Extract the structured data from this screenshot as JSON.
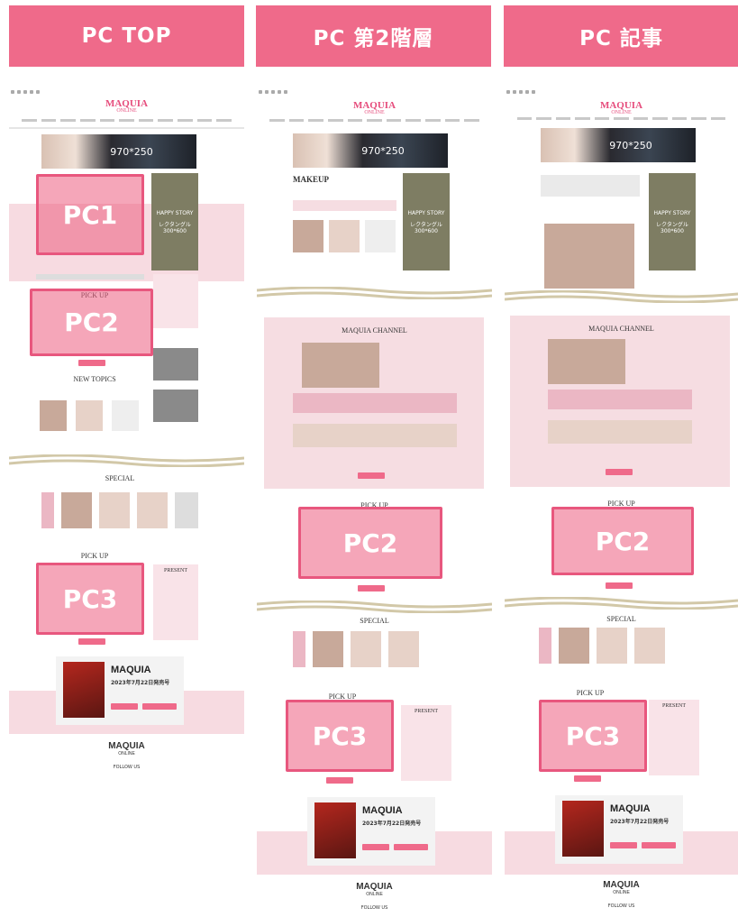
{
  "headers": [
    {
      "label": "PC TOP"
    },
    {
      "label": "PC 第2階層"
    },
    {
      "label": "PC 記事"
    }
  ],
  "logo": {
    "name": "MAQUIA",
    "sub": "ONLINE"
  },
  "banner": {
    "size": "970*250"
  },
  "side_ad": {
    "title": "HAPPY STORY",
    "size": "レクタングル\n300*600"
  },
  "overlays": {
    "pc1": "PC1",
    "pc2": "PC2",
    "pc3": "PC3"
  },
  "sections": {
    "pickup": "PICK UP",
    "new_topics": "NEW TOPICS",
    "special": "SPECIAL",
    "makeup": "MAKEUP",
    "channel": "MAQUIA CHANNEL",
    "present": "PRESENT",
    "follow": "FOLLOW US"
  },
  "magazine": {
    "title": "MAQUIA",
    "date": "2023年7月22日発売号"
  },
  "colors": {
    "accent": "#ef6a8a",
    "overlay": "#e8577e",
    "band": "#f7dbe1",
    "logo": "#e64c7c"
  }
}
